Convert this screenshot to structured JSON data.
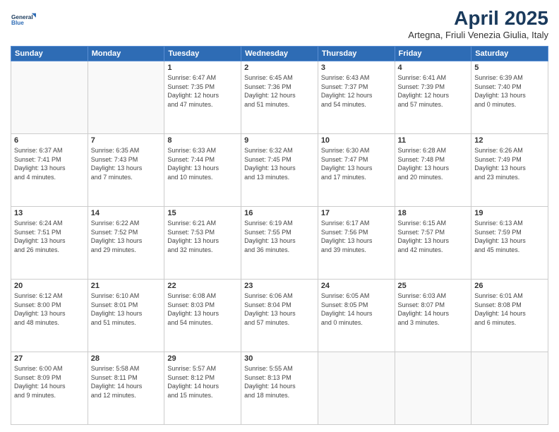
{
  "logo": {
    "line1": "General",
    "line2": "Blue"
  },
  "header": {
    "title": "April 2025",
    "subtitle": "Artegna, Friuli Venezia Giulia, Italy"
  },
  "columns": [
    "Sunday",
    "Monday",
    "Tuesday",
    "Wednesday",
    "Thursday",
    "Friday",
    "Saturday"
  ],
  "weeks": [
    [
      {
        "day": "",
        "info": ""
      },
      {
        "day": "",
        "info": ""
      },
      {
        "day": "1",
        "info": "Sunrise: 6:47 AM\nSunset: 7:35 PM\nDaylight: 12 hours\nand 47 minutes."
      },
      {
        "day": "2",
        "info": "Sunrise: 6:45 AM\nSunset: 7:36 PM\nDaylight: 12 hours\nand 51 minutes."
      },
      {
        "day": "3",
        "info": "Sunrise: 6:43 AM\nSunset: 7:37 PM\nDaylight: 12 hours\nand 54 minutes."
      },
      {
        "day": "4",
        "info": "Sunrise: 6:41 AM\nSunset: 7:39 PM\nDaylight: 12 hours\nand 57 minutes."
      },
      {
        "day": "5",
        "info": "Sunrise: 6:39 AM\nSunset: 7:40 PM\nDaylight: 13 hours\nand 0 minutes."
      }
    ],
    [
      {
        "day": "6",
        "info": "Sunrise: 6:37 AM\nSunset: 7:41 PM\nDaylight: 13 hours\nand 4 minutes."
      },
      {
        "day": "7",
        "info": "Sunrise: 6:35 AM\nSunset: 7:43 PM\nDaylight: 13 hours\nand 7 minutes."
      },
      {
        "day": "8",
        "info": "Sunrise: 6:33 AM\nSunset: 7:44 PM\nDaylight: 13 hours\nand 10 minutes."
      },
      {
        "day": "9",
        "info": "Sunrise: 6:32 AM\nSunset: 7:45 PM\nDaylight: 13 hours\nand 13 minutes."
      },
      {
        "day": "10",
        "info": "Sunrise: 6:30 AM\nSunset: 7:47 PM\nDaylight: 13 hours\nand 17 minutes."
      },
      {
        "day": "11",
        "info": "Sunrise: 6:28 AM\nSunset: 7:48 PM\nDaylight: 13 hours\nand 20 minutes."
      },
      {
        "day": "12",
        "info": "Sunrise: 6:26 AM\nSunset: 7:49 PM\nDaylight: 13 hours\nand 23 minutes."
      }
    ],
    [
      {
        "day": "13",
        "info": "Sunrise: 6:24 AM\nSunset: 7:51 PM\nDaylight: 13 hours\nand 26 minutes."
      },
      {
        "day": "14",
        "info": "Sunrise: 6:22 AM\nSunset: 7:52 PM\nDaylight: 13 hours\nand 29 minutes."
      },
      {
        "day": "15",
        "info": "Sunrise: 6:21 AM\nSunset: 7:53 PM\nDaylight: 13 hours\nand 32 minutes."
      },
      {
        "day": "16",
        "info": "Sunrise: 6:19 AM\nSunset: 7:55 PM\nDaylight: 13 hours\nand 36 minutes."
      },
      {
        "day": "17",
        "info": "Sunrise: 6:17 AM\nSunset: 7:56 PM\nDaylight: 13 hours\nand 39 minutes."
      },
      {
        "day": "18",
        "info": "Sunrise: 6:15 AM\nSunset: 7:57 PM\nDaylight: 13 hours\nand 42 minutes."
      },
      {
        "day": "19",
        "info": "Sunrise: 6:13 AM\nSunset: 7:59 PM\nDaylight: 13 hours\nand 45 minutes."
      }
    ],
    [
      {
        "day": "20",
        "info": "Sunrise: 6:12 AM\nSunset: 8:00 PM\nDaylight: 13 hours\nand 48 minutes."
      },
      {
        "day": "21",
        "info": "Sunrise: 6:10 AM\nSunset: 8:01 PM\nDaylight: 13 hours\nand 51 minutes."
      },
      {
        "day": "22",
        "info": "Sunrise: 6:08 AM\nSunset: 8:03 PM\nDaylight: 13 hours\nand 54 minutes."
      },
      {
        "day": "23",
        "info": "Sunrise: 6:06 AM\nSunset: 8:04 PM\nDaylight: 13 hours\nand 57 minutes."
      },
      {
        "day": "24",
        "info": "Sunrise: 6:05 AM\nSunset: 8:05 PM\nDaylight: 14 hours\nand 0 minutes."
      },
      {
        "day": "25",
        "info": "Sunrise: 6:03 AM\nSunset: 8:07 PM\nDaylight: 14 hours\nand 3 minutes."
      },
      {
        "day": "26",
        "info": "Sunrise: 6:01 AM\nSunset: 8:08 PM\nDaylight: 14 hours\nand 6 minutes."
      }
    ],
    [
      {
        "day": "27",
        "info": "Sunrise: 6:00 AM\nSunset: 8:09 PM\nDaylight: 14 hours\nand 9 minutes."
      },
      {
        "day": "28",
        "info": "Sunrise: 5:58 AM\nSunset: 8:11 PM\nDaylight: 14 hours\nand 12 minutes."
      },
      {
        "day": "29",
        "info": "Sunrise: 5:57 AM\nSunset: 8:12 PM\nDaylight: 14 hours\nand 15 minutes."
      },
      {
        "day": "30",
        "info": "Sunrise: 5:55 AM\nSunset: 8:13 PM\nDaylight: 14 hours\nand 18 minutes."
      },
      {
        "day": "",
        "info": ""
      },
      {
        "day": "",
        "info": ""
      },
      {
        "day": "",
        "info": ""
      }
    ]
  ]
}
